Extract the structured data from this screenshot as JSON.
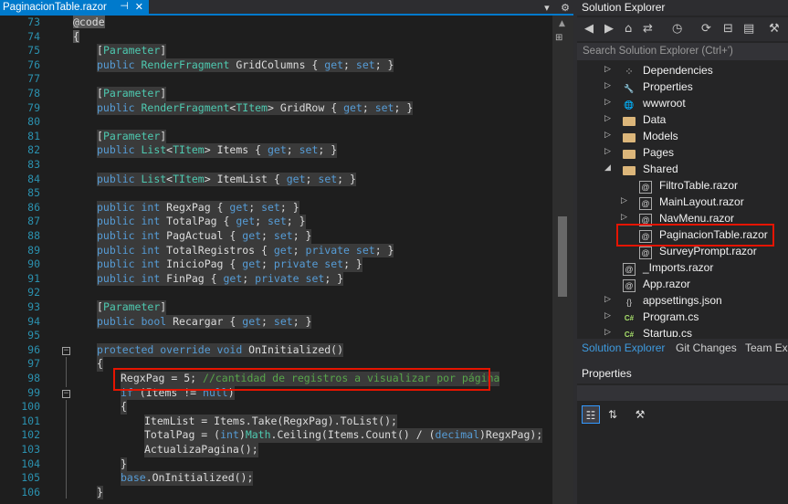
{
  "editor": {
    "tab_title": "PaginacionTable.razor",
    "tab_close": "✕",
    "tab_pin": "⊣",
    "right_icons": [
      "▾",
      "⚙"
    ],
    "lines": [
      {
        "n": "73"
      },
      {
        "n": "74"
      },
      {
        "n": "75"
      },
      {
        "n": "76"
      },
      {
        "n": "77"
      },
      {
        "n": "78"
      },
      {
        "n": "79"
      },
      {
        "n": "80"
      },
      {
        "n": "81"
      },
      {
        "n": "82"
      },
      {
        "n": "83"
      },
      {
        "n": "84"
      },
      {
        "n": "85"
      },
      {
        "n": "86"
      },
      {
        "n": "87"
      },
      {
        "n": "88"
      },
      {
        "n": "89"
      },
      {
        "n": "90"
      },
      {
        "n": "91"
      },
      {
        "n": "92"
      },
      {
        "n": "93"
      },
      {
        "n": "94"
      },
      {
        "n": "95"
      },
      {
        "n": "96"
      },
      {
        "n": "97"
      },
      {
        "n": "98"
      },
      {
        "n": "99"
      },
      {
        "n": "100"
      },
      {
        "n": "101"
      },
      {
        "n": "102"
      },
      {
        "n": "103"
      },
      {
        "n": "104"
      },
      {
        "n": "105"
      },
      {
        "n": "106"
      }
    ],
    "code": {
      "l73": "@code",
      "l74": "{",
      "l75a": "[",
      "l75b": "Parameter",
      "l75c": "]",
      "l76a": "public ",
      "l76b": "RenderFragment",
      "l76c": " GridColumns { ",
      "l76d": "get",
      "l76e": "; ",
      "l76f": "set",
      "l76g": "; }",
      "l78a": "[",
      "l78b": "Parameter",
      "l78c": "]",
      "l79a": "public ",
      "l79b": "RenderFragment",
      "l79c": "<",
      "l79d": "TItem",
      "l79e": "> GridRow { ",
      "l79f": "get",
      "l79g": "; ",
      "l79h": "set",
      "l79i": "; }",
      "l81a": "[",
      "l81b": "Parameter",
      "l81c": "]",
      "l82a": "public ",
      "l82b": "List",
      "l82c": "<",
      "l82d": "TItem",
      "l82e": "> Items { ",
      "l82f": "get",
      "l82g": "; ",
      "l82h": "set",
      "l82i": "; }",
      "l84a": "public ",
      "l84b": "List",
      "l84c": "<",
      "l84d": "TItem",
      "l84e": "> ItemList { ",
      "l84f": "get",
      "l84g": "; ",
      "l84h": "set",
      "l84i": "; }",
      "l86a": "public ",
      "l86b": "int",
      "l86c": " RegxPag { ",
      "l86d": "get",
      "l86e": "; ",
      "l86f": "set",
      "l86g": "; }",
      "l87a": "public ",
      "l87b": "int",
      "l87c": " TotalPag { ",
      "l87d": "get",
      "l87e": "; ",
      "l87f": "set",
      "l87g": "; }",
      "l88a": "public ",
      "l88b": "int",
      "l88c": " PagActual { ",
      "l88d": "get",
      "l88e": "; ",
      "l88f": "set",
      "l88g": "; }",
      "l89a": "public ",
      "l89b": "int",
      "l89c": " TotalRegistros { ",
      "l89d": "get",
      "l89e": "; ",
      "l89f": "private set",
      "l89g": "; }",
      "l90a": "public ",
      "l90b": "int",
      "l90c": " InicioPag { ",
      "l90d": "get",
      "l90e": "; ",
      "l90f": "private set",
      "l90g": "; }",
      "l91a": "public ",
      "l91b": "int",
      "l91c": " FinPag { ",
      "l91d": "get",
      "l91e": "; ",
      "l91f": "private set",
      "l91g": "; }",
      "l93a": "[",
      "l93b": "Parameter",
      "l93c": "]",
      "l94a": "public ",
      "l94b": "bool",
      "l94c": " Recargar { ",
      "l94d": "get",
      "l94e": "; ",
      "l94f": "set",
      "l94g": "; }",
      "l96a": "protected override void ",
      "l96b": "OnInitialized()",
      "l97": "{",
      "l98a": "RegxPag = 5; ",
      "l98b": "//cantidad de registros a visualizar por página",
      "l99a": "if",
      "l99b": " (Items != ",
      "l99c": "null",
      "l99d": ")",
      "l100": "{",
      "l101a": "ItemList = Items.Take(RegxPag).ToList();",
      "l102a": "TotalPag = (",
      "l102b": "int",
      "l102c": ")",
      "l102d": "Math",
      "l102e": ".Ceiling(Items.Count() / (",
      "l102f": "decimal",
      "l102g": ")RegxPag);",
      "l103a": "ActualizaPagina();",
      "l104": "}",
      "l105a": "base",
      "l105b": ".OnInitialized();",
      "l106": "}"
    }
  },
  "solution_explorer": {
    "title": "Solution Explorer",
    "search_placeholder": "Search Solution Explorer (Ctrl+')",
    "items": [
      {
        "label": "Dependencies",
        "icon": "⁘"
      },
      {
        "label": "Properties",
        "icon": "🔧"
      },
      {
        "label": "wwwroot",
        "icon": "🌐"
      },
      {
        "label": "Data",
        "icon": ""
      },
      {
        "label": "Models",
        "icon": ""
      },
      {
        "label": "Pages",
        "icon": ""
      },
      {
        "label": "Shared",
        "icon": ""
      },
      {
        "label": "FiltroTable.razor",
        "icon": "@"
      },
      {
        "label": "MainLayout.razor",
        "icon": "@"
      },
      {
        "label": "NavMenu.razor",
        "icon": "@"
      },
      {
        "label": "PaginacionTable.razor",
        "icon": "@"
      },
      {
        "label": "SurveyPrompt.razor",
        "icon": "@"
      },
      {
        "label": "_Imports.razor",
        "icon": "@"
      },
      {
        "label": "App.razor",
        "icon": "@"
      },
      {
        "label": "appsettings.json",
        "icon": "{}"
      },
      {
        "label": "Program.cs",
        "icon": "C#"
      },
      {
        "label": "Startup.cs",
        "icon": "C#"
      }
    ],
    "bottom_tabs": [
      "Solution Explorer",
      "Git Changes",
      "Team Exp"
    ]
  },
  "properties": {
    "title": "Properties"
  },
  "colors": {
    "accent": "#007acc",
    "highlight_box": "#e51400"
  }
}
